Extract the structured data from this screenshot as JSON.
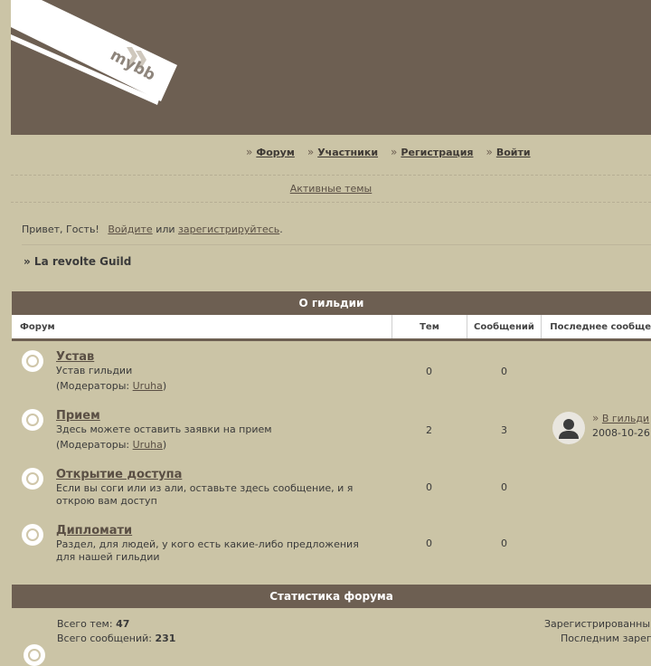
{
  "logo": {
    "text": "mybb"
  },
  "nav": [
    {
      "label": "Форум"
    },
    {
      "label": "Участники"
    },
    {
      "label": "Регистрация"
    },
    {
      "label": "Войти"
    }
  ],
  "subnav": {
    "active_topics": "Активные темы"
  },
  "welcome": {
    "greeting": "Привет, Гость!",
    "login": "Войдите",
    "or": "или",
    "register": "зарегистрируйтесь",
    "period": "."
  },
  "breadcrumb": "» La revolte Guild",
  "about": {
    "title": "О гильдии",
    "col_forum": "Форум",
    "col_topics": "Тем",
    "col_posts": "Сообщений",
    "col_last": "Последнее сообще",
    "mod_prefix": "(Модераторы:",
    "mod_suffix": ")",
    "forums": [
      {
        "name": "Устав",
        "desc": "Устав гильдии",
        "moderator": "Uruha",
        "topics": "0",
        "posts": "0"
      },
      {
        "name": "Прием",
        "desc": "Здесь можете оставить заявки на прием",
        "moderator": "Uruha",
        "topics": "2",
        "posts": "3",
        "last_link": "В гильди",
        "last_date": "2008-10-26"
      },
      {
        "name": "Открытие доступа",
        "desc": "Если вы соги или из али, оставьте здесь сообщение, и я открою вам доступ",
        "topics": "0",
        "posts": "0"
      },
      {
        "name": "Дипломати",
        "desc": "Раздел, для людей, у кого есть какие-либо предложения для нашей гильдии",
        "topics": "0",
        "posts": "0"
      }
    ]
  },
  "stats": {
    "title": "Статистика форума",
    "total_topics_label": "Всего тем:",
    "total_topics": "47",
    "total_posts_label": "Всего сообщений:",
    "total_posts": "231",
    "registered": "Зарегистрированны",
    "last_registered": "Последним зарег"
  },
  "colors": {
    "background": "#cbc4a6",
    "header": "#6d5f52",
    "link": "#5a4f44"
  }
}
